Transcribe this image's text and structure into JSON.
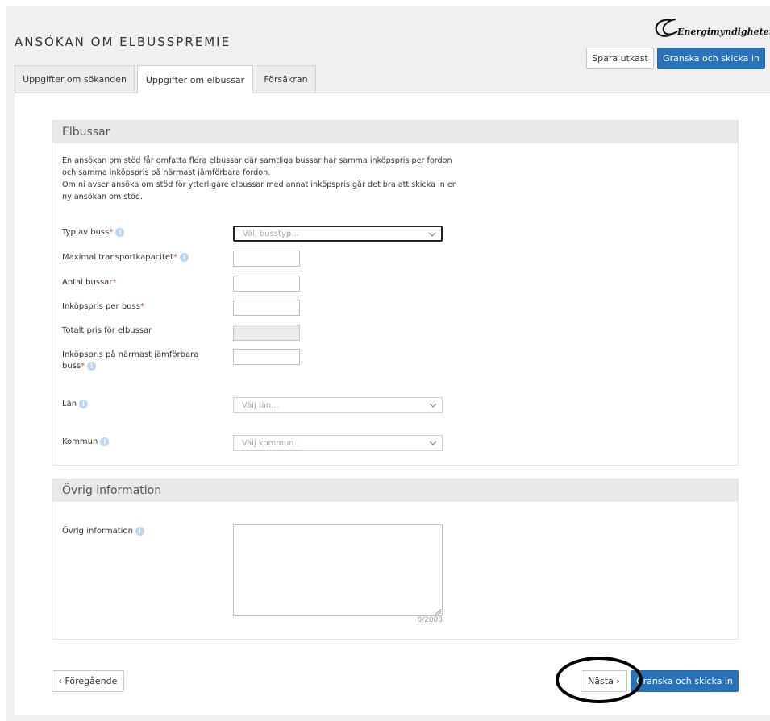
{
  "header": {
    "title": "ANSÖKAN OM ELBUSSPREMIE",
    "logo_text": "Energimyndigheten",
    "save_draft": "Spara utkast",
    "review_submit": "Granska och skicka in"
  },
  "tabs": [
    {
      "label": "Uppgifter om sökanden",
      "active": false
    },
    {
      "label": "Uppgifter om elbussar",
      "active": true
    },
    {
      "label": "Försäkran",
      "active": false
    }
  ],
  "elbussar": {
    "heading": "Elbussar",
    "intro_line1": "En ansökan om stöd får omfatta flera elbussar där samtliga bussar har samma inköpspris per fordon",
    "intro_line2": "och samma inköpspris på närmast jämförbara fordon.",
    "intro_line3": "Om ni avser ansöka om stöd för ytterligare elbussar med annat inköpspris går det bra att skicka in en",
    "intro_line4": "ny ansökan om stöd.",
    "bus_type_label": "Typ av buss",
    "bus_type_placeholder": "Välj busstyp...",
    "max_capacity_label": "Maximal transportkapacitet",
    "num_buses_label": "Antal bussar",
    "price_per_bus_label": "Inköpspris per buss",
    "total_price_label": "Totalt pris för elbussar",
    "comparable_price_label_line1": "Inköpspris på närmast jämförbara",
    "comparable_price_label_line2": "buss",
    "county_label": "Län",
    "county_placeholder": "Välj län...",
    "municipality_label": "Kommun",
    "municipality_placeholder": "Välj kommun..."
  },
  "ovrig": {
    "heading": "Övrig information",
    "field_label": "Övrig information",
    "counter": "0/2000"
  },
  "footer": {
    "previous": "‹ Föregående",
    "next": "Nästa ›",
    "review_submit": "Granska och skicka in"
  },
  "colors": {
    "primary": "#2a73b8",
    "required": "#d33333",
    "info_icon": "#bcd6ee",
    "background": "#f0f0f0"
  }
}
